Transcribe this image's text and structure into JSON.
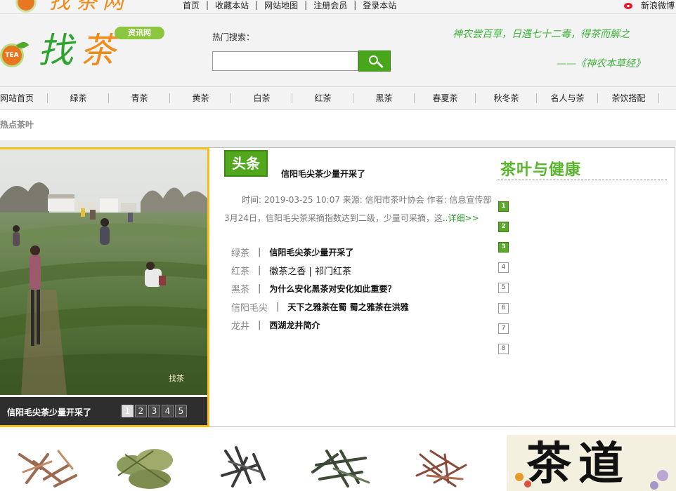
{
  "top_bar": {
    "logo_fragment_text": "找茶网",
    "nav_links": [
      "首页",
      "收藏本站",
      "网站地图",
      "注册会员",
      "登录本站"
    ],
    "separator": "|",
    "weibo_label": "新浪微博"
  },
  "header": {
    "logo_text_green": "找",
    "logo_text_orange": "茶",
    "logo_badge": "TEA",
    "logo_tag": "资讯网",
    "hot_search_label": "热门搜索：",
    "search_placeholder": "",
    "slogan_line1": "神农尝百草，日遇七十二毒，得茶而解之",
    "slogan_line2": "——《神农本草经》"
  },
  "main_nav": [
    "网站首页",
    "绿茶",
    "青茶",
    "黄茶",
    "白茶",
    "红茶",
    "黑茶",
    "春夏茶",
    "秋冬茶",
    "名人与茶",
    "茶饮搭配"
  ],
  "hot_section": {
    "title": "热点茶叶"
  },
  "slideshow": {
    "caption": "信阳毛尖茶少量开采了",
    "pages": [
      "1",
      "2",
      "3",
      "4",
      "5"
    ],
    "active_page": 1,
    "watermark": "找茶"
  },
  "headline": {
    "badge": "头条",
    "title": "信阳毛尖茶少量开采了",
    "meta": "时间: 2019-03-25 10:07 来源: 信阳市茶叶协会 作者: 信息宣传部",
    "summary": "3月24日，信阳毛尖茶采摘指数达到二级，少量可采摘，这",
    "more_label": "..详细>>"
  },
  "news_list": [
    {
      "category": "绿茶",
      "title": "信阳毛尖茶少量开采了",
      "bold": true
    },
    {
      "category": "红茶",
      "title": "徽茶之香 | 祁门红茶",
      "bold": false
    },
    {
      "category": "黑茶",
      "title": "为什么安化黑茶对安化如此重要？",
      "bold": true
    },
    {
      "category": "信阳毛尖",
      "title": "天下之雅茶在蜀 蜀之雅茶在洪雅",
      "bold": true
    },
    {
      "category": "龙井",
      "title": "西湖龙井简介",
      "bold": true
    }
  ],
  "health": {
    "title": "茶叶与健康",
    "numbers": [
      "1",
      "2",
      "3",
      "4",
      "5",
      "6",
      "7",
      "8"
    ],
    "highlighted_count": 3
  },
  "bottom": {
    "banner_text": "茶道"
  },
  "colors": {
    "brand_green": "#52a81d",
    "brand_orange": "#f08c1a",
    "slide_border": "#f5bd17",
    "slogan_green": "#3eb33a"
  }
}
